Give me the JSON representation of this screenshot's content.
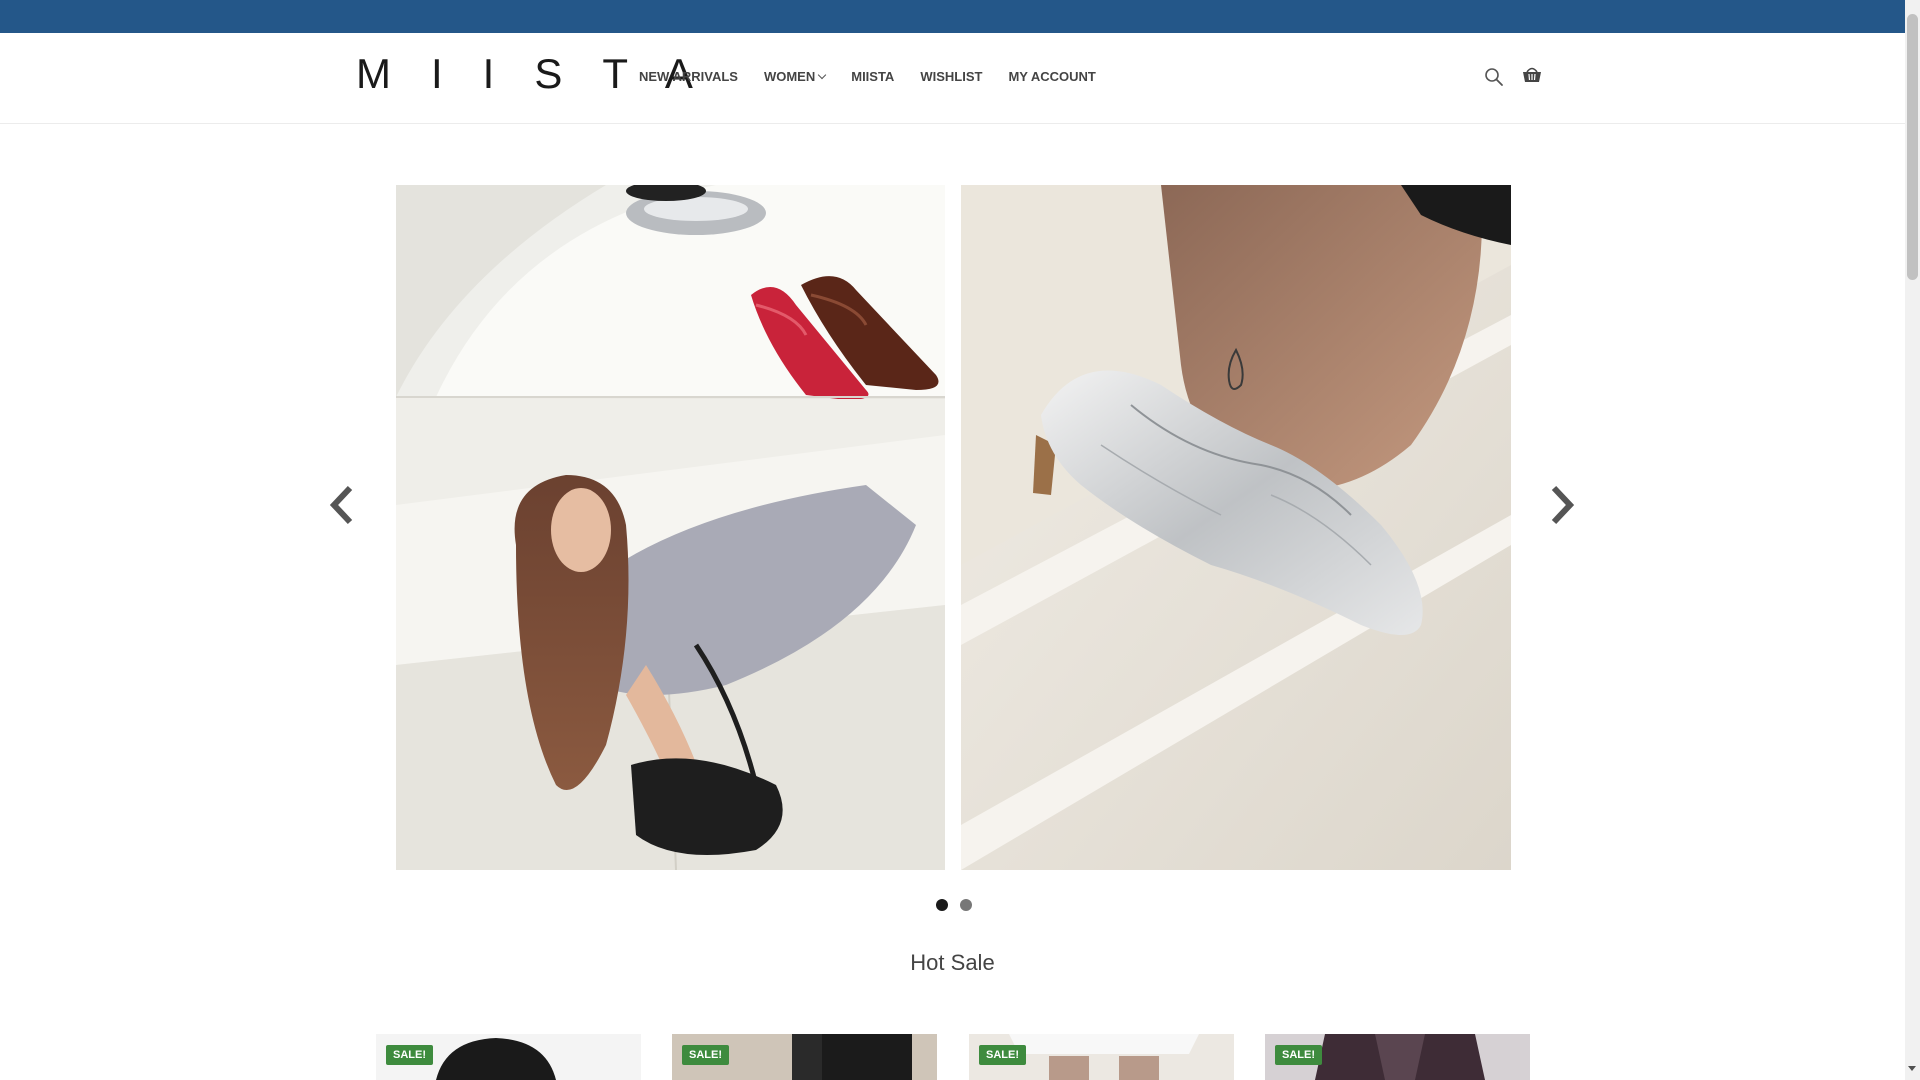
{
  "brand": {
    "logo_text": "MIISTA",
    "accent_color": "#245789"
  },
  "nav": {
    "items": [
      {
        "label": "NEW ARRIVALS"
      },
      {
        "label": "WOMEN",
        "has_dropdown": true
      },
      {
        "label": "MIISTA"
      },
      {
        "label": "WISHLIST"
      },
      {
        "label": "MY ACCOUNT"
      }
    ]
  },
  "header_icons": [
    "search-icon",
    "basket-icon"
  ],
  "carousel": {
    "slides": [
      {
        "name": "model-with-bag-and-mary-jane-shoes"
      },
      {
        "name": "silver-flat-shoe-closeup"
      }
    ],
    "dots": 2,
    "active_dot": 0
  },
  "hot_sale": {
    "title": "Hot Sale",
    "products": [
      {
        "badge": "SALE!"
      },
      {
        "badge": "SALE!"
      },
      {
        "badge": "SALE!"
      },
      {
        "badge": "SALE!"
      }
    ]
  }
}
